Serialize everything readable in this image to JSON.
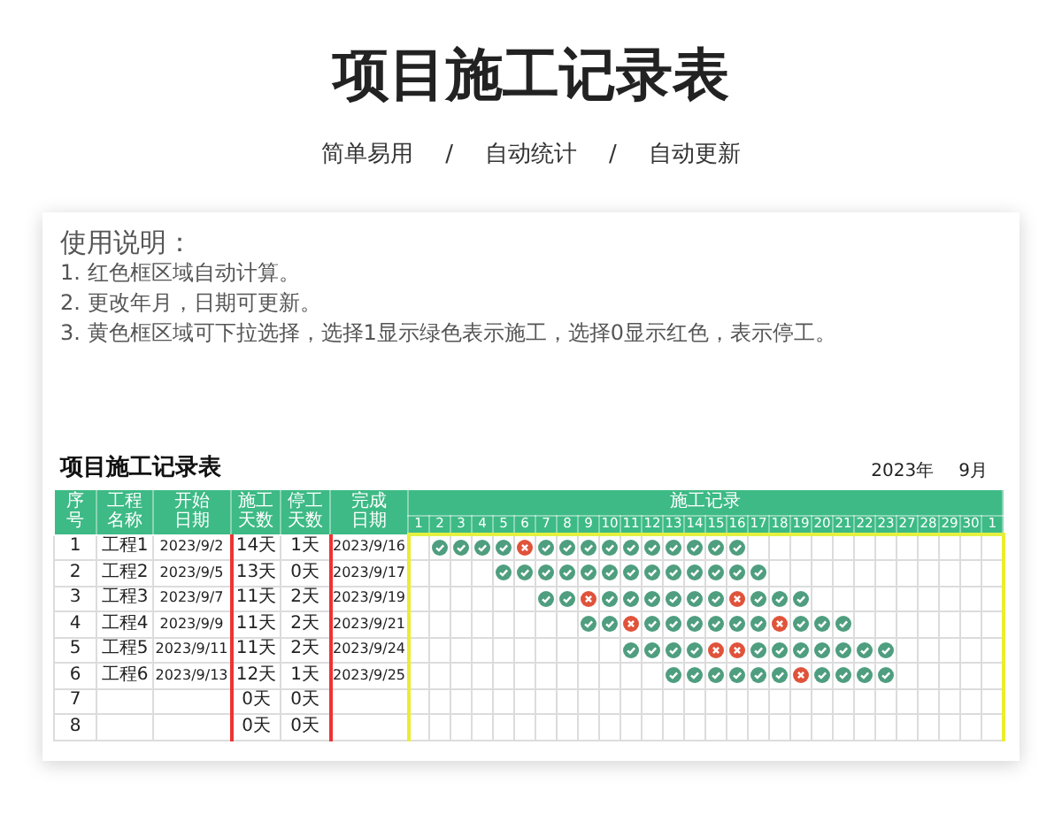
{
  "title": "项目施工记录表",
  "tagline": [
    "简单易用",
    "/",
    "自动统计",
    "/",
    "自动更新"
  ],
  "instructions": {
    "heading": "使用说明：",
    "lines": [
      "1. 红色框区域自动计算。",
      "2. 更改年月，日期可更新。",
      "3. 黄色框区域可下拉选择，选择1显示绿色表示施工，选择0显示红色，表示停工。"
    ]
  },
  "sheet": {
    "title": "项目施工记录表",
    "year": "2023年",
    "month": "9月",
    "columns": [
      "序号",
      "工程名称",
      "开始日期",
      "施工天数",
      "停工天数",
      "完成日期"
    ],
    "group_header": "施工记录",
    "days": [
      "1",
      "2",
      "3",
      "4",
      "5",
      "6",
      "7",
      "8",
      "9",
      "10",
      "11",
      "12",
      "13",
      "14",
      "15",
      "16",
      "17",
      "18",
      "19",
      "20",
      "21",
      "22",
      "23",
      "27",
      "28",
      "29",
      "30",
      "1"
    ],
    "rows": [
      {
        "cells": [
          "1",
          "工程1",
          "2023/9/2",
          "14天",
          "1天",
          "2023/9/16"
        ],
        "marks": [
          {
            "filled": false
          },
          {
            "filled": true,
            "stopped": false
          },
          {
            "filled": true,
            "stopped": false
          },
          {
            "filled": true,
            "stopped": false
          },
          {
            "filled": true,
            "stopped": false
          },
          {
            "filled": true,
            "stopped": true
          },
          {
            "filled": true,
            "stopped": false
          },
          {
            "filled": true,
            "stopped": false
          },
          {
            "filled": true,
            "stopped": false
          },
          {
            "filled": true,
            "stopped": false
          },
          {
            "filled": true,
            "stopped": false
          },
          {
            "filled": true,
            "stopped": false
          },
          {
            "filled": true,
            "stopped": false
          },
          {
            "filled": true,
            "stopped": false
          },
          {
            "filled": true,
            "stopped": false
          },
          {
            "filled": true,
            "stopped": false
          },
          {
            "filled": false
          },
          {
            "filled": false
          },
          {
            "filled": false
          },
          {
            "filled": false
          },
          {
            "filled": false
          },
          {
            "filled": false
          },
          {
            "filled": false
          },
          {
            "filled": false
          },
          {
            "filled": false
          },
          {
            "filled": false
          },
          {
            "filled": false
          },
          {
            "filled": false
          }
        ]
      },
      {
        "cells": [
          "2",
          "工程2",
          "2023/9/5",
          "13天",
          "0天",
          "2023/9/17"
        ],
        "marks": [
          {
            "filled": false
          },
          {
            "filled": false
          },
          {
            "filled": false
          },
          {
            "filled": false
          },
          {
            "filled": true,
            "stopped": false
          },
          {
            "filled": true,
            "stopped": false
          },
          {
            "filled": true,
            "stopped": false
          },
          {
            "filled": true,
            "stopped": false
          },
          {
            "filled": true,
            "stopped": false
          },
          {
            "filled": true,
            "stopped": false
          },
          {
            "filled": true,
            "stopped": false
          },
          {
            "filled": true,
            "stopped": false
          },
          {
            "filled": true,
            "stopped": false
          },
          {
            "filled": true,
            "stopped": false
          },
          {
            "filled": true,
            "stopped": false
          },
          {
            "filled": true,
            "stopped": false
          },
          {
            "filled": true,
            "stopped": false
          },
          {
            "filled": false
          },
          {
            "filled": false
          },
          {
            "filled": false
          },
          {
            "filled": false
          },
          {
            "filled": false
          },
          {
            "filled": false
          },
          {
            "filled": false
          },
          {
            "filled": false
          },
          {
            "filled": false
          },
          {
            "filled": false
          },
          {
            "filled": false
          }
        ]
      },
      {
        "cells": [
          "3",
          "工程3",
          "2023/9/7",
          "11天",
          "2天",
          "2023/9/19"
        ],
        "marks": [
          {
            "filled": false
          },
          {
            "filled": false
          },
          {
            "filled": false
          },
          {
            "filled": false
          },
          {
            "filled": false
          },
          {
            "filled": false
          },
          {
            "filled": true,
            "stopped": false
          },
          {
            "filled": true,
            "stopped": false
          },
          {
            "filled": true,
            "stopped": true
          },
          {
            "filled": true,
            "stopped": false
          },
          {
            "filled": true,
            "stopped": false
          },
          {
            "filled": true,
            "stopped": false
          },
          {
            "filled": true,
            "stopped": false
          },
          {
            "filled": true,
            "stopped": false
          },
          {
            "filled": true,
            "stopped": false
          },
          {
            "filled": true,
            "stopped": true
          },
          {
            "filled": true,
            "stopped": false
          },
          {
            "filled": true,
            "stopped": false
          },
          {
            "filled": true,
            "stopped": false
          },
          {
            "filled": false
          },
          {
            "filled": false
          },
          {
            "filled": false
          },
          {
            "filled": false
          },
          {
            "filled": false
          },
          {
            "filled": false
          },
          {
            "filled": false
          },
          {
            "filled": false
          },
          {
            "filled": false
          }
        ]
      },
      {
        "cells": [
          "4",
          "工程4",
          "2023/9/9",
          "11天",
          "2天",
          "2023/9/21"
        ],
        "marks": [
          {
            "filled": false
          },
          {
            "filled": false
          },
          {
            "filled": false
          },
          {
            "filled": false
          },
          {
            "filled": false
          },
          {
            "filled": false
          },
          {
            "filled": false
          },
          {
            "filled": false
          },
          {
            "filled": true,
            "stopped": false
          },
          {
            "filled": true,
            "stopped": false
          },
          {
            "filled": true,
            "stopped": true
          },
          {
            "filled": true,
            "stopped": false
          },
          {
            "filled": true,
            "stopped": false
          },
          {
            "filled": true,
            "stopped": false
          },
          {
            "filled": true,
            "stopped": false
          },
          {
            "filled": true,
            "stopped": false
          },
          {
            "filled": true,
            "stopped": false
          },
          {
            "filled": true,
            "stopped": true
          },
          {
            "filled": true,
            "stopped": false
          },
          {
            "filled": true,
            "stopped": false
          },
          {
            "filled": true,
            "stopped": false
          },
          {
            "filled": false
          },
          {
            "filled": false
          },
          {
            "filled": false
          },
          {
            "filled": false
          },
          {
            "filled": false
          },
          {
            "filled": false
          },
          {
            "filled": false
          }
        ]
      },
      {
        "cells": [
          "5",
          "工程5",
          "2023/9/11",
          "11天",
          "2天",
          "2023/9/24"
        ],
        "marks": [
          {
            "filled": false
          },
          {
            "filled": false
          },
          {
            "filled": false
          },
          {
            "filled": false
          },
          {
            "filled": false
          },
          {
            "filled": false
          },
          {
            "filled": false
          },
          {
            "filled": false
          },
          {
            "filled": false
          },
          {
            "filled": false
          },
          {
            "filled": true,
            "stopped": false
          },
          {
            "filled": true,
            "stopped": false
          },
          {
            "filled": true,
            "stopped": false
          },
          {
            "filled": true,
            "stopped": false
          },
          {
            "filled": true,
            "stopped": true
          },
          {
            "filled": true,
            "stopped": true
          },
          {
            "filled": true,
            "stopped": false
          },
          {
            "filled": true,
            "stopped": false
          },
          {
            "filled": true,
            "stopped": false
          },
          {
            "filled": true,
            "stopped": false
          },
          {
            "filled": true,
            "stopped": false
          },
          {
            "filled": true,
            "stopped": false
          },
          {
            "filled": true,
            "stopped": false
          },
          {
            "filled": false
          },
          {
            "filled": false
          },
          {
            "filled": false
          },
          {
            "filled": false
          },
          {
            "filled": false
          }
        ]
      },
      {
        "cells": [
          "6",
          "工程6",
          "2023/9/13",
          "12天",
          "1天",
          "2023/9/25"
        ],
        "marks": [
          {
            "filled": false
          },
          {
            "filled": false
          },
          {
            "filled": false
          },
          {
            "filled": false
          },
          {
            "filled": false
          },
          {
            "filled": false
          },
          {
            "filled": false
          },
          {
            "filled": false
          },
          {
            "filled": false
          },
          {
            "filled": false
          },
          {
            "filled": false
          },
          {
            "filled": false
          },
          {
            "filled": true,
            "stopped": false
          },
          {
            "filled": true,
            "stopped": false
          },
          {
            "filled": true,
            "stopped": false
          },
          {
            "filled": true,
            "stopped": false
          },
          {
            "filled": true,
            "stopped": false
          },
          {
            "filled": true,
            "stopped": false
          },
          {
            "filled": true,
            "stopped": true
          },
          {
            "filled": true,
            "stopped": false
          },
          {
            "filled": true,
            "stopped": false
          },
          {
            "filled": true,
            "stopped": false
          },
          {
            "filled": true,
            "stopped": false
          },
          {
            "filled": false
          },
          {
            "filled": false
          },
          {
            "filled": false
          },
          {
            "filled": false
          },
          {
            "filled": false
          }
        ]
      },
      {
        "cells": [
          "7",
          null,
          null,
          "0天",
          "0天",
          null
        ]
      },
      {
        "cells": [
          "8",
          null,
          null,
          "0天",
          "0天",
          null
        ]
      }
    ]
  }
}
